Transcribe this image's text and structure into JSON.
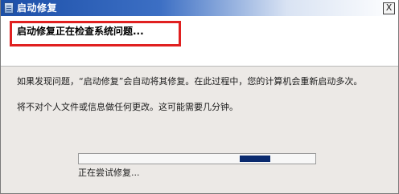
{
  "window": {
    "title": "启动修复",
    "close_glyph": "X"
  },
  "header": {
    "title": "启动修复正在检查系统问题..."
  },
  "body": {
    "paragraph1": "如果发现问题，“启动修复”会自动将其修复。在此过程中，您的计算机会重新启动多次。",
    "paragraph2": "将不对个人文件或信息做任何更改。这可能需要几分钟。"
  },
  "progress": {
    "mode": "indeterminate",
    "status": "正在尝试修复..."
  },
  "colors": {
    "title_bar_start": "#1c4fa8",
    "highlight_border": "#e02020",
    "progress_fill": "#0a2a6e"
  }
}
